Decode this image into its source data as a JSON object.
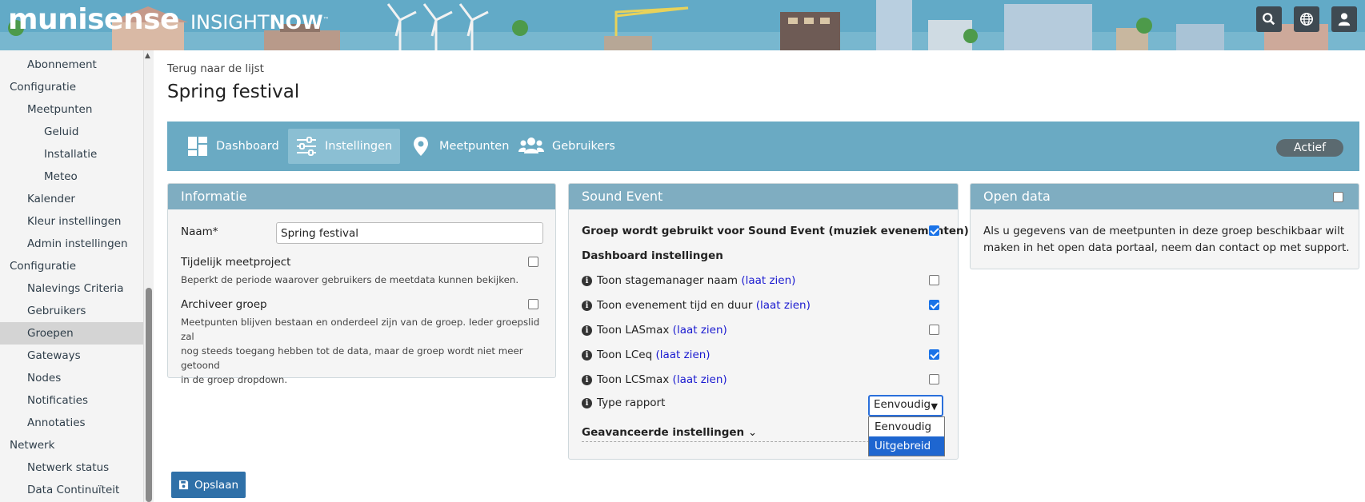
{
  "brand": {
    "name": "munisense",
    "product_light": "INSIGHT",
    "product_bold": "NOW",
    "tm": "™"
  },
  "header_icons": [
    "search-icon",
    "globe-icon",
    "user-icon"
  ],
  "sidebar": {
    "items": [
      {
        "label": "Abonnement",
        "level": 1
      },
      {
        "label": "Configuratie",
        "level": 0
      },
      {
        "label": "Meetpunten",
        "level": 1
      },
      {
        "label": "Geluid",
        "level": 2
      },
      {
        "label": "Installatie",
        "level": 2
      },
      {
        "label": "Meteo",
        "level": 2
      },
      {
        "label": "Kalender",
        "level": 1
      },
      {
        "label": "Kleur instellingen",
        "level": 1
      },
      {
        "label": "Admin instellingen",
        "level": 1
      },
      {
        "label": "Configuratie",
        "level": 0
      },
      {
        "label": "Nalevings Criteria",
        "level": 1
      },
      {
        "label": "Gebruikers",
        "level": 1
      },
      {
        "label": "Groepen",
        "level": 1,
        "active": true
      },
      {
        "label": "Gateways",
        "level": 1
      },
      {
        "label": "Nodes",
        "level": 1
      },
      {
        "label": "Notificaties",
        "level": 1
      },
      {
        "label": "Annotaties",
        "level": 1
      },
      {
        "label": "Netwerk",
        "level": 0
      },
      {
        "label": "Netwerk status",
        "level": 1
      },
      {
        "label": "Data Continuïteit",
        "level": 1
      }
    ]
  },
  "main": {
    "back_link": "Terug naar de lijst",
    "title": "Spring festival",
    "tabs": [
      {
        "label": "Dashboard",
        "icon": "dashboard-icon"
      },
      {
        "label": "Instellingen",
        "icon": "sliders-icon",
        "active": true
      },
      {
        "label": "Meetpunten",
        "icon": "map-pin-icon"
      },
      {
        "label": "Gebruikers",
        "icon": "users-icon"
      }
    ],
    "status": "Actief"
  },
  "informatie": {
    "title": "Informatie",
    "name_label": "Naam*",
    "name_value": "Spring festival",
    "temp_label": "Tijdelijk meetproject",
    "temp_checked": false,
    "temp_desc": "Beperkt de periode waarover gebruikers de meetdata kunnen bekijken.",
    "archive_label": "Archiveer groep",
    "archive_checked": false,
    "archive_desc_1": "Meetpunten blijven bestaan en onderdeel zijn van de groep. Ieder groepslid zal",
    "archive_desc_2": "nog steeds toegang hebben tot de data, maar de groep wordt niet meer getoond",
    "archive_desc_3": "in de groep dropdown."
  },
  "sound_event": {
    "title": "Sound Event",
    "used_label": "Groep wordt gebruikt voor Sound Event (muziek evenementen)",
    "used_checked": true,
    "dashboard_heading": "Dashboard instellingen",
    "show_link": "(laat zien)",
    "options": [
      {
        "label": "Toon stagemanager naam",
        "checked": false
      },
      {
        "label": "Toon evenement tijd en duur",
        "checked": true
      },
      {
        "label": "Toon LASmax",
        "checked": false
      },
      {
        "label": "Toon LCeq",
        "checked": true
      },
      {
        "label": "Toon LCSmax",
        "checked": false
      }
    ],
    "report_label": "Type rapport",
    "report_value": "Eenvoudig",
    "report_options": [
      "Eenvoudig",
      "Uitgebreid"
    ],
    "report_highlighted": "Uitgebreid",
    "advanced_label": "Geavanceerde instellingen"
  },
  "open_data": {
    "title": "Open data",
    "checked": false,
    "text_1": "Als u gegevens van de meetpunten in deze groep beschikbaar wilt",
    "text_2": "maken in het open data portaal, neem dan contact op met support."
  },
  "save_label": "Opslaan"
}
